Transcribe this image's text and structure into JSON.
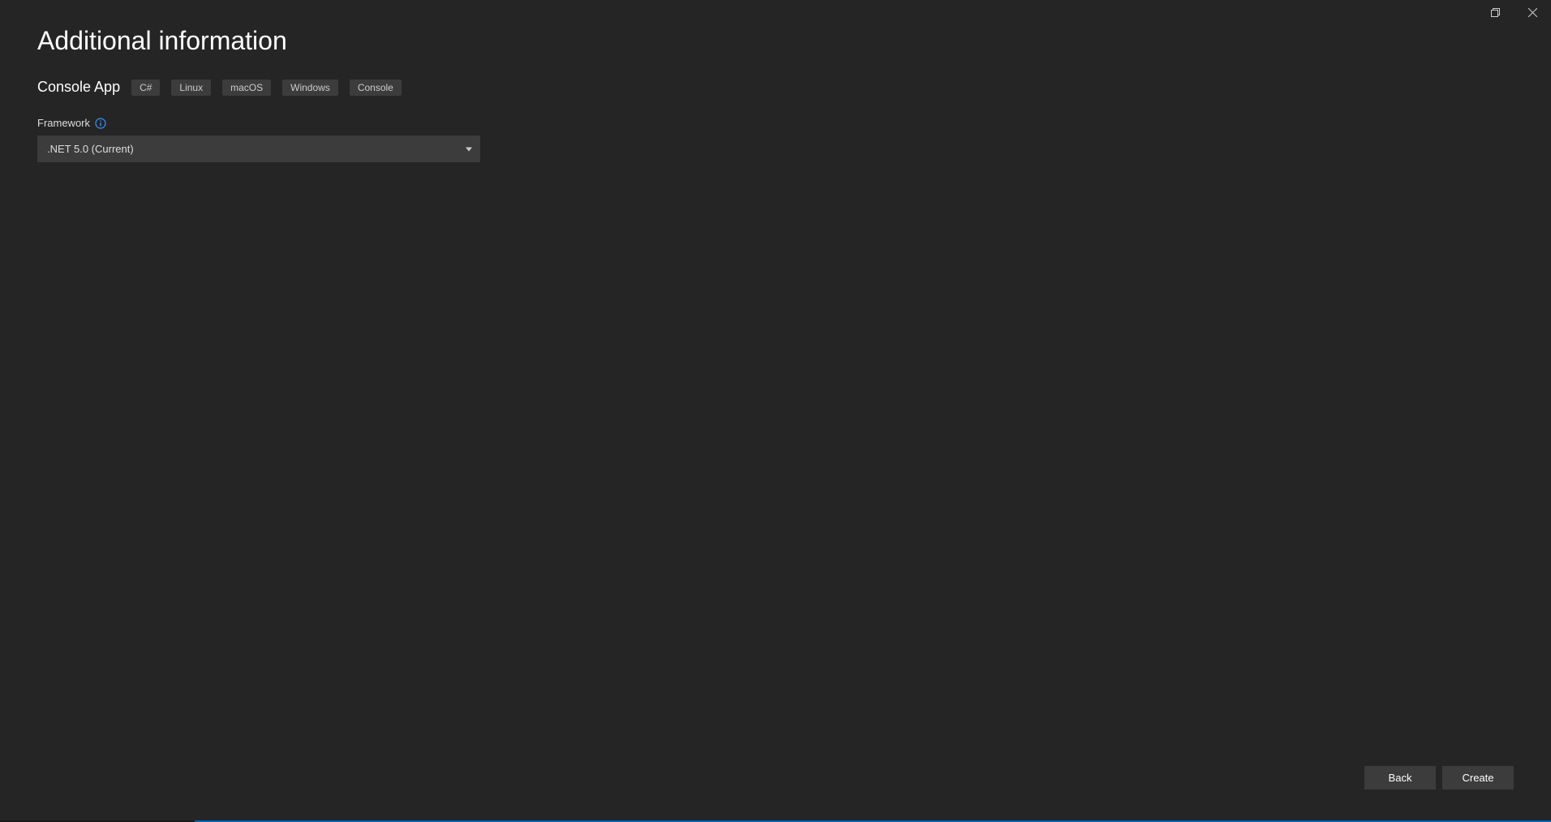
{
  "header": {
    "title": "Additional information"
  },
  "template": {
    "name": "Console App",
    "tags": [
      "C#",
      "Linux",
      "macOS",
      "Windows",
      "Console"
    ]
  },
  "framework": {
    "label": "Framework",
    "selected": ".NET 5.0 (Current)"
  },
  "footer": {
    "back": "Back",
    "create": "Create"
  }
}
